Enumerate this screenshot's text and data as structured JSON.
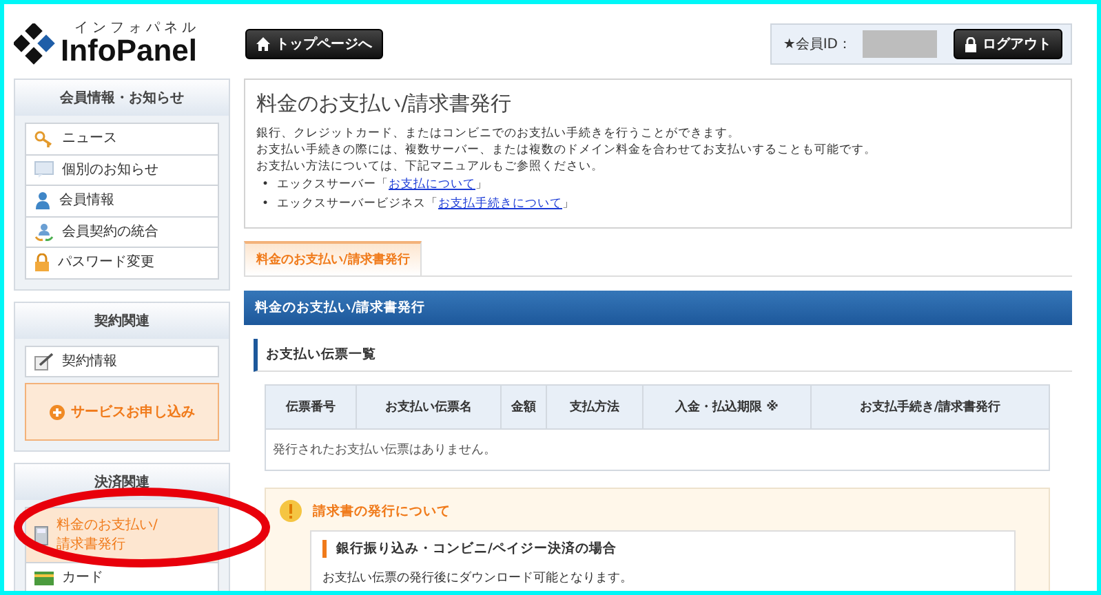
{
  "header": {
    "logo_kana": "インフォパネル",
    "logo_text": "InfoPanel",
    "top_button": "トップページへ",
    "member_id_label": "★会員ID：",
    "logout_button": "ログアウト"
  },
  "sidebar": [
    {
      "title": "会員情報・お知らせ",
      "items": [
        {
          "kind": "key",
          "label": "ニュース",
          "selected": false
        },
        {
          "kind": "message",
          "label": "個別のお知らせ",
          "selected": false
        },
        {
          "kind": "person",
          "label": "会員情報",
          "selected": false
        },
        {
          "kind": "people",
          "label": "会員契約の統合",
          "selected": false
        },
        {
          "kind": "lock",
          "label": "パスワード変更",
          "selected": false
        }
      ]
    },
    {
      "title": "契約関連",
      "items": [
        {
          "kind": "pen",
          "label": "契約情報",
          "selected": false
        },
        {
          "kind": "action",
          "label": "サービスお申し込み"
        }
      ]
    },
    {
      "title": "決済関連",
      "items": [
        {
          "kind": "calculator",
          "label": "料金のお支払い/請求書発行",
          "selected": true
        },
        {
          "kind": "card",
          "label": "カード",
          "selected": false
        }
      ]
    }
  ],
  "main": {
    "title": "料金のお支払い/請求書発行",
    "description": [
      "銀行、クレジットカード、またはコンビニでのお支払い手続きを行うことができます。",
      "お支払い手続きの際には、複数サーバー、または複数のドメイン料金を合わせてお支払いすることも可能です。",
      "お支払い方法については、下記マニュアルもご参照ください。"
    ],
    "links": [
      {
        "bullet": "•",
        "before": "エックスサーバー「",
        "link": "お支払について",
        "after": "」"
      },
      {
        "bullet": "•",
        "before": "エックスサーバービジネス「",
        "link": "お支払手続きについて",
        "after": "」"
      }
    ],
    "tabs": [
      {
        "label": "料金のお支払い/請求書発行",
        "selected": true
      }
    ],
    "panel_title": "料金のお支払い/請求書発行",
    "subheading": "お支払い伝票一覧",
    "table": {
      "columns": [
        "伝票番号",
        "お支払い伝票名",
        "金額",
        "支払方法",
        "入金・払込期限 ※",
        "お支払手続き/請求書発行"
      ],
      "empty_message": "発行されたお支払い伝票はありません。"
    },
    "notice": {
      "title": "請求書の発行について",
      "subheading": "銀行振り込み・コンビニ/ペイジー決済の場合",
      "text": "お支払い伝票の発行後にダウンロード可能となります。"
    }
  }
}
